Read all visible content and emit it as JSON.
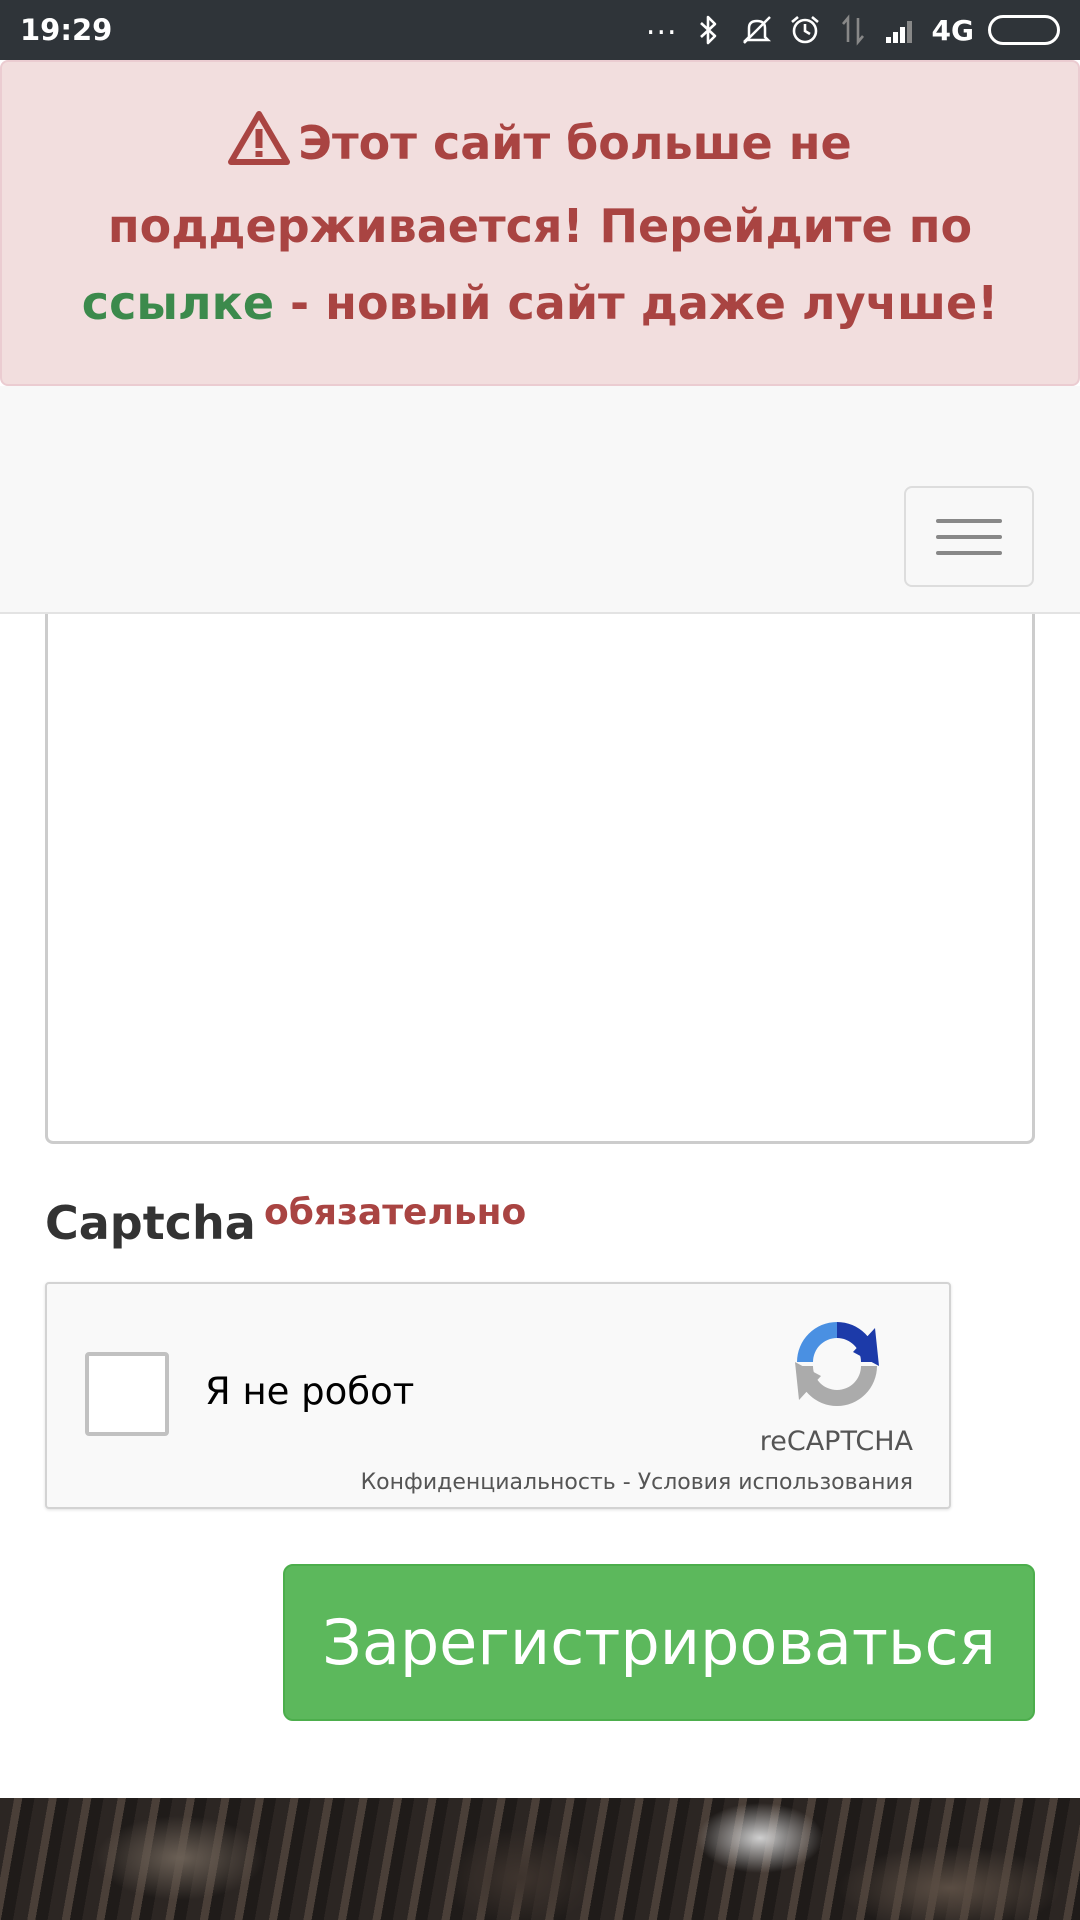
{
  "status_bar": {
    "time": "19:29",
    "dots": "...",
    "network": "4G",
    "icons": [
      "bluetooth-icon",
      "mute-icon",
      "alarm-icon",
      "data-icon",
      "signal-icon",
      "battery-icon"
    ]
  },
  "alert": {
    "text_before_link": "Этот сайт больше не поддерживается! Перейдите по ",
    "link_text": "ссылке",
    "text_after_link": " - новый сайт даже лучше!",
    "icon": "warning-triangle-icon",
    "colors": {
      "text": "#a94442",
      "link": "#3c8a4c",
      "background": "#f2dede"
    }
  },
  "navbar": {
    "menu_icon": "hamburger-menu-icon"
  },
  "form": {
    "captcha_label": "Captcha",
    "required_label": "обязательно",
    "recaptcha": {
      "checkbox_label": "Я не робот",
      "brand": "reCAPTCHA",
      "terms": "Конфиденциальность - Условия использования"
    },
    "submit_label": "Зарегистрироваться",
    "colors": {
      "submit": "#5cb85c"
    }
  }
}
